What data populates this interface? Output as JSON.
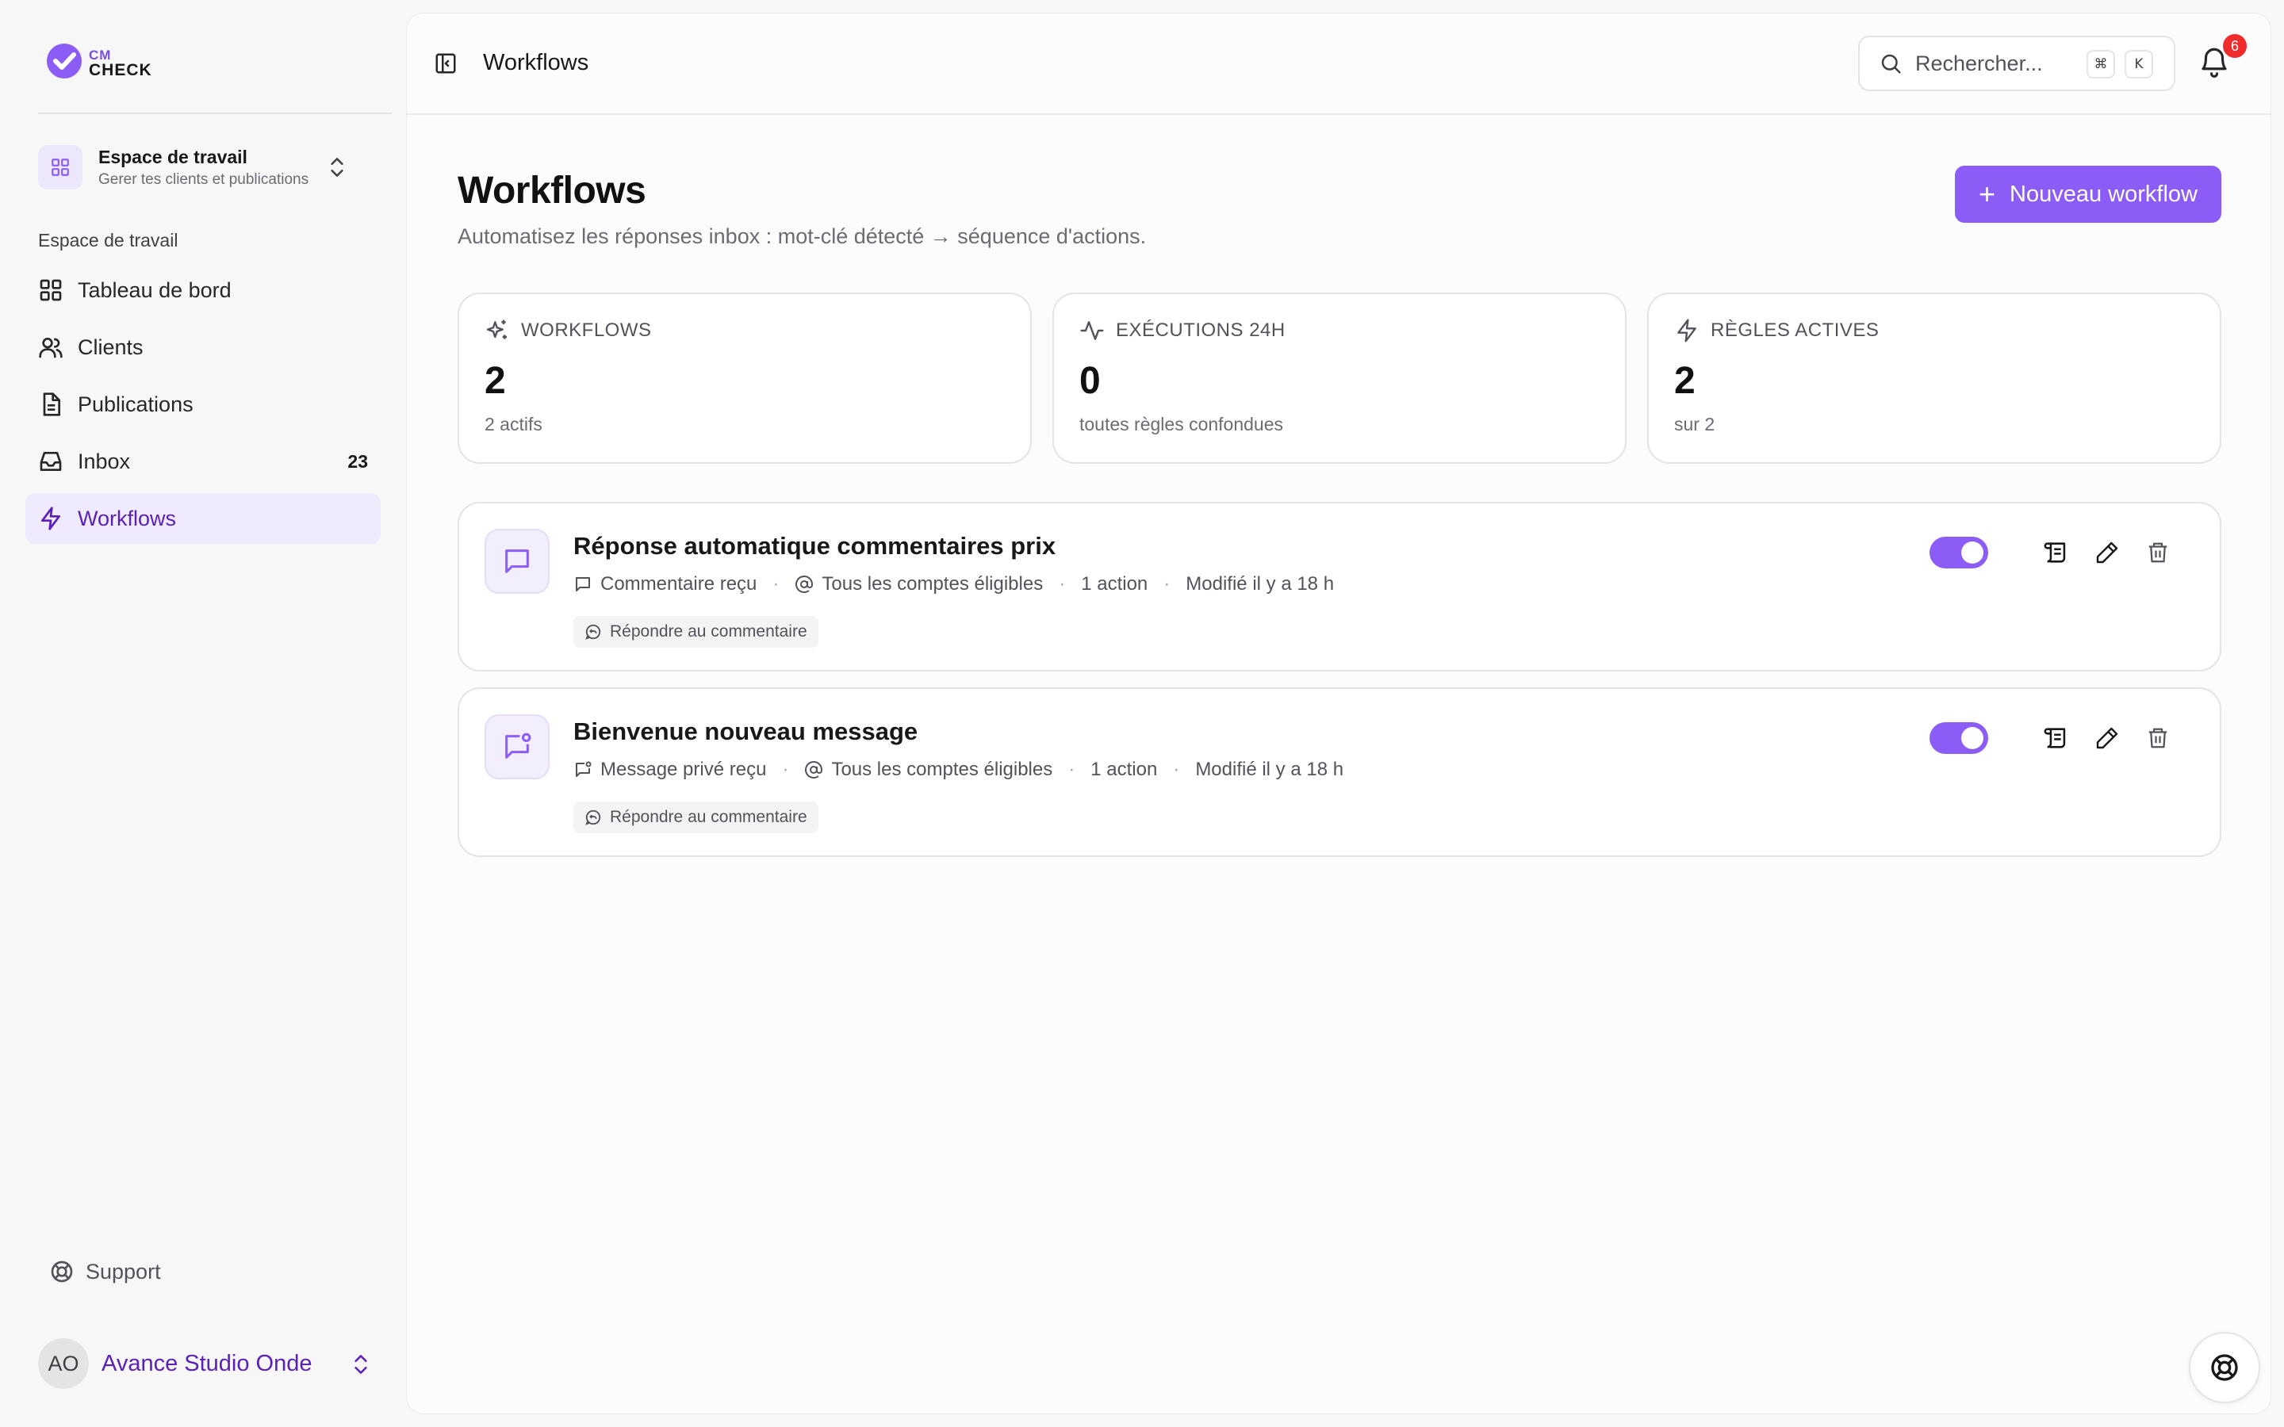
{
  "brand": {
    "top": "CM",
    "bottom": "CHECK",
    "accent": "#8b5cf6"
  },
  "workspace": {
    "title": "Espace de travail",
    "subtitle": "Gerer tes clients et publications"
  },
  "sidebar": {
    "section_label": "Espace de travail",
    "items": [
      {
        "label": "Tableau de bord",
        "icon": "dashboard-icon"
      },
      {
        "label": "Clients",
        "icon": "users-icon"
      },
      {
        "label": "Publications",
        "icon": "document-icon"
      },
      {
        "label": "Inbox",
        "icon": "inbox-icon",
        "count": "23"
      },
      {
        "label": "Workflows",
        "icon": "lightning-icon",
        "active": true
      }
    ],
    "support_label": "Support"
  },
  "account": {
    "initials": "AO",
    "name": "Avance Studio Onde"
  },
  "topbar": {
    "title": "Workflows",
    "search_placeholder": "Rechercher...",
    "shortcut_mod": "⌘",
    "shortcut_key": "K",
    "notifications_count": "6"
  },
  "page": {
    "title": "Workflows",
    "subtitle": "Automatisez les réponses inbox : mot-clé détecté → séquence d'actions.",
    "new_button": "Nouveau workflow"
  },
  "stats": [
    {
      "label": "WORKFLOWS",
      "value": "2",
      "note": "2 actifs",
      "icon": "sparkles-icon"
    },
    {
      "label": "EXÉCUTIONS 24H",
      "value": "0",
      "note": "toutes règles confondues",
      "icon": "activity-icon"
    },
    {
      "label": "RÈGLES ACTIVES",
      "value": "2",
      "note": "sur 2",
      "icon": "lightning-icon"
    }
  ],
  "workflows": [
    {
      "title": "Réponse automatique commentaires prix",
      "trigger": "Commentaire reçu",
      "accounts": "Tous les comptes éligibles",
      "actions": "1 action",
      "modified": "Modifié il y a 18 h",
      "chip": "Répondre au commentaire",
      "enabled": true
    },
    {
      "title": "Bienvenue nouveau message",
      "trigger": "Message privé reçu",
      "accounts": "Tous les comptes éligibles",
      "actions": "1 action",
      "modified": "Modifié il y a 18 h",
      "chip": "Répondre au commentaire",
      "enabled": true
    }
  ]
}
